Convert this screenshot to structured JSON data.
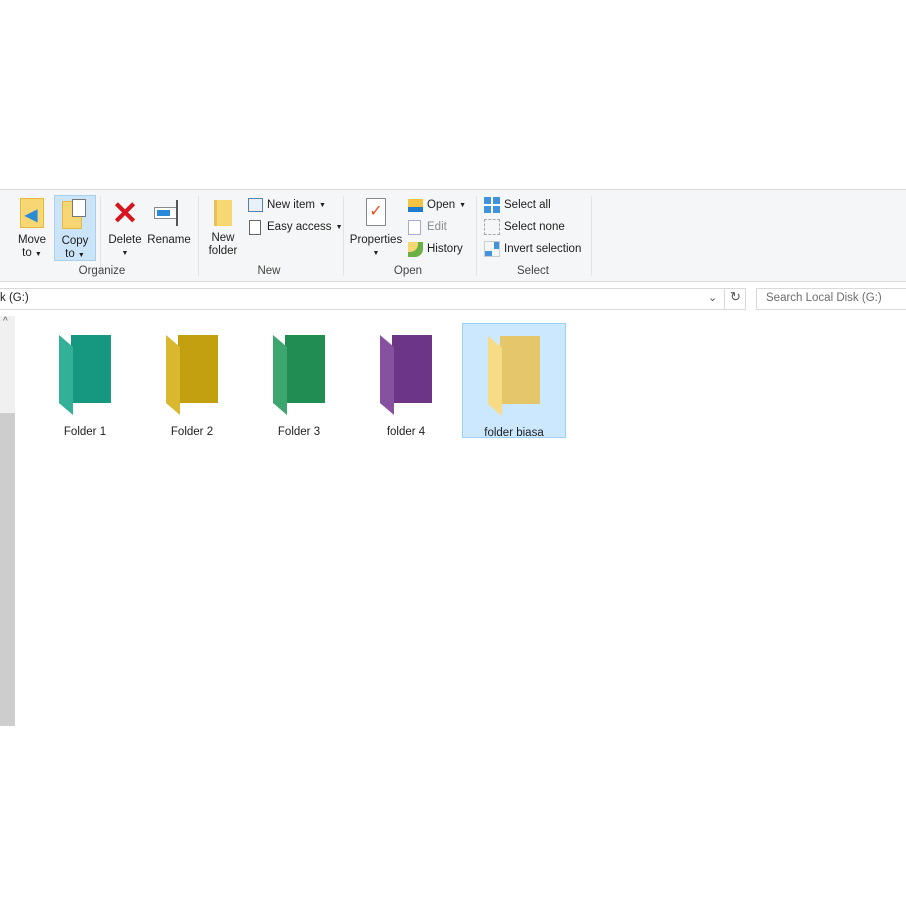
{
  "ribbon": {
    "organize": {
      "label": "Organize",
      "move_to": [
        "Move",
        "to"
      ],
      "copy_to": [
        "Copy",
        "to"
      ],
      "delete": "Delete",
      "rename": "Rename"
    },
    "new": {
      "label": "New",
      "new_folder": [
        "New",
        "folder"
      ],
      "new_item": "New item",
      "easy_access": "Easy access"
    },
    "open": {
      "label": "Open",
      "properties": "Properties",
      "open": "Open",
      "edit": "Edit",
      "history": "History"
    },
    "select": {
      "label": "Select",
      "select_all": "Select all",
      "select_none": "Select none",
      "invert": "Invert selection"
    }
  },
  "address": {
    "path": "k (G:)"
  },
  "search": {
    "placeholder": "Search Local Disk (G:)"
  },
  "items": [
    {
      "name": "Folder 1",
      "color": "#17a58a"
    },
    {
      "name": "Folder 2",
      "color": "#d4ae12"
    },
    {
      "name": "Folder 3",
      "color": "#23995a"
    },
    {
      "name": "folder 4",
      "color": "#763a92"
    },
    {
      "name": "folder biasa",
      "color": "#f8d775",
      "selected": true
    }
  ]
}
